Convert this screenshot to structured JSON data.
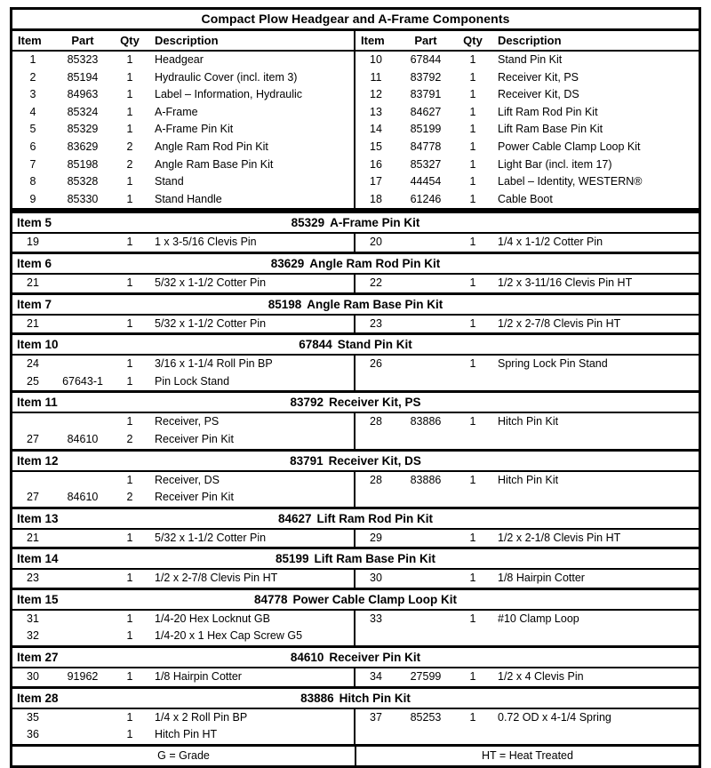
{
  "title": "Compact Plow Headgear and A-Frame Components",
  "columns": {
    "item": "Item",
    "part": "Part",
    "qty": "Qty",
    "description": "Description"
  },
  "main_left": [
    {
      "item": "1",
      "part": "85323",
      "qty": "1",
      "description": "Headgear"
    },
    {
      "item": "2",
      "part": "85194",
      "qty": "1",
      "description": "Hydraulic Cover (incl. item 3)"
    },
    {
      "item": "3",
      "part": "84963",
      "qty": "1",
      "description": "Label – Information, Hydraulic"
    },
    {
      "item": "4",
      "part": "85324",
      "qty": "1",
      "description": "A-Frame"
    },
    {
      "item": "5",
      "part": "85329",
      "qty": "1",
      "description": "A-Frame Pin Kit"
    },
    {
      "item": "6",
      "part": "83629",
      "qty": "2",
      "description": "Angle Ram Rod Pin Kit"
    },
    {
      "item": "7",
      "part": "85198",
      "qty": "2",
      "description": "Angle Ram Base Pin Kit"
    },
    {
      "item": "8",
      "part": "85328",
      "qty": "1",
      "description": "Stand"
    },
    {
      "item": "9",
      "part": "85330",
      "qty": "1",
      "description": "Stand Handle"
    }
  ],
  "main_right": [
    {
      "item": "10",
      "part": "67844",
      "qty": "1",
      "description": "Stand Pin Kit"
    },
    {
      "item": "11",
      "part": "83792",
      "qty": "1",
      "description": "Receiver Kit, PS"
    },
    {
      "item": "12",
      "part": "83791",
      "qty": "1",
      "description": "Receiver Kit, DS"
    },
    {
      "item": "13",
      "part": "84627",
      "qty": "1",
      "description": "Lift Ram Rod Pin Kit"
    },
    {
      "item": "14",
      "part": "85199",
      "qty": "1",
      "description": "Lift Ram Base Pin Kit"
    },
    {
      "item": "15",
      "part": "84778",
      "qty": "1",
      "description": "Power Cable Clamp Loop Kit"
    },
    {
      "item": "16",
      "part": "85327",
      "qty": "1",
      "description": "Light Bar (incl. item 17)"
    },
    {
      "item": "17",
      "part": "44454",
      "qty": "1",
      "description": "Label – Identity, WESTERN®"
    },
    {
      "item": "18",
      "part": "61246",
      "qty": "1",
      "description": "Cable Boot"
    }
  ],
  "kits": [
    {
      "item_label": "Item 5",
      "part": "85329",
      "name": "A-Frame Pin Kit",
      "left": [
        {
          "item": "19",
          "part": "",
          "qty": "1",
          "description": "1 x 3-5/16 Clevis Pin"
        }
      ],
      "right": [
        {
          "item": "20",
          "part": "",
          "qty": "1",
          "description": "1/4 x 1-1/2 Cotter Pin"
        }
      ]
    },
    {
      "item_label": "Item 6",
      "part": "83629",
      "name": "Angle Ram Rod Pin Kit",
      "left": [
        {
          "item": "21",
          "part": "",
          "qty": "1",
          "description": "5/32 x 1-1/2 Cotter Pin"
        }
      ],
      "right": [
        {
          "item": "22",
          "part": "",
          "qty": "1",
          "description": "1/2 x 3-11/16 Clevis Pin HT"
        }
      ]
    },
    {
      "item_label": "Item 7",
      "part": "85198",
      "name": "Angle Ram Base Pin Kit",
      "left": [
        {
          "item": "21",
          "part": "",
          "qty": "1",
          "description": "5/32 x 1-1/2 Cotter Pin"
        }
      ],
      "right": [
        {
          "item": "23",
          "part": "",
          "qty": "1",
          "description": "1/2 x 2-7/8 Clevis Pin HT"
        }
      ]
    },
    {
      "item_label": "Item 10",
      "part": "67844",
      "name": "Stand Pin Kit",
      "left": [
        {
          "item": "24",
          "part": "",
          "qty": "1",
          "description": "3/16 x 1-1/4 Roll Pin BP"
        },
        {
          "item": "25",
          "part": "67643-1",
          "qty": "1",
          "description": "Pin Lock Stand"
        }
      ],
      "right": [
        {
          "item": "26",
          "part": "",
          "qty": "1",
          "description": "Spring Lock Pin Stand"
        },
        {
          "item": "",
          "part": "",
          "qty": "",
          "description": ""
        }
      ]
    },
    {
      "item_label": "Item 11",
      "part": "83792",
      "name": "Receiver Kit, PS",
      "left": [
        {
          "item": "",
          "part": "",
          "qty": "1",
          "description": "Receiver, PS"
        },
        {
          "item": "27",
          "part": "84610",
          "qty": "2",
          "description": "Receiver Pin Kit"
        }
      ],
      "right": [
        {
          "item": "28",
          "part": "83886",
          "qty": "1",
          "description": "Hitch Pin Kit"
        },
        {
          "item": "",
          "part": "",
          "qty": "",
          "description": ""
        }
      ]
    },
    {
      "item_label": "Item 12",
      "part": "83791",
      "name": "Receiver Kit, DS",
      "left": [
        {
          "item": "",
          "part": "",
          "qty": "1",
          "description": "Receiver, DS"
        },
        {
          "item": "27",
          "part": "84610",
          "qty": "2",
          "description": "Receiver Pin Kit"
        }
      ],
      "right": [
        {
          "item": "28",
          "part": "83886",
          "qty": "1",
          "description": "Hitch Pin Kit"
        },
        {
          "item": "",
          "part": "",
          "qty": "",
          "description": ""
        }
      ]
    },
    {
      "item_label": "Item 13",
      "part": "84627",
      "name": "Lift Ram Rod Pin Kit",
      "left": [
        {
          "item": "21",
          "part": "",
          "qty": "1",
          "description": "5/32 x 1-1/2 Cotter Pin"
        }
      ],
      "right": [
        {
          "item": "29",
          "part": "",
          "qty": "1",
          "description": "1/2 x 2-1/8 Clevis Pin HT"
        }
      ]
    },
    {
      "item_label": "Item 14",
      "part": "85199",
      "name": "Lift Ram Base Pin Kit",
      "left": [
        {
          "item": "23",
          "part": "",
          "qty": "1",
          "description": "1/2 x 2-7/8 Clevis Pin HT"
        }
      ],
      "right": [
        {
          "item": "30",
          "part": "",
          "qty": "1",
          "description": "1/8 Hairpin Cotter"
        }
      ]
    },
    {
      "item_label": "Item 15",
      "part": "84778",
      "name": "Power Cable Clamp Loop Kit",
      "left": [
        {
          "item": "31",
          "part": "",
          "qty": "1",
          "description": "1/4-20 Hex Locknut GB"
        },
        {
          "item": "32",
          "part": "",
          "qty": "1",
          "description": "1/4-20 x 1 Hex Cap Screw G5"
        }
      ],
      "right": [
        {
          "item": "33",
          "part": "",
          "qty": "1",
          "description": "#10 Clamp Loop"
        },
        {
          "item": "",
          "part": "",
          "qty": "",
          "description": ""
        }
      ]
    },
    {
      "item_label": "Item 27",
      "part": "84610",
      "name": "Receiver Pin Kit",
      "left": [
        {
          "item": "30",
          "part": "91962",
          "qty": "1",
          "description": "1/8 Hairpin Cotter"
        }
      ],
      "right": [
        {
          "item": "34",
          "part": "27599",
          "qty": "1",
          "description": "1/2 x 4 Clevis Pin"
        }
      ]
    },
    {
      "item_label": "Item 28",
      "part": "83886",
      "name": "Hitch Pin Kit",
      "left": [
        {
          "item": "35",
          "part": "",
          "qty": "1",
          "description": "1/4 x 2 Roll Pin BP"
        },
        {
          "item": "36",
          "part": "",
          "qty": "1",
          "description": "Hitch Pin HT"
        }
      ],
      "right": [
        {
          "item": "37",
          "part": "85253",
          "qty": "1",
          "description": "0.72 OD x 4-1/4 Spring"
        },
        {
          "item": "",
          "part": "",
          "qty": "",
          "description": ""
        }
      ]
    }
  ],
  "legend": {
    "grade": "G = Grade",
    "heat_treated": "HT = Heat Treated"
  }
}
